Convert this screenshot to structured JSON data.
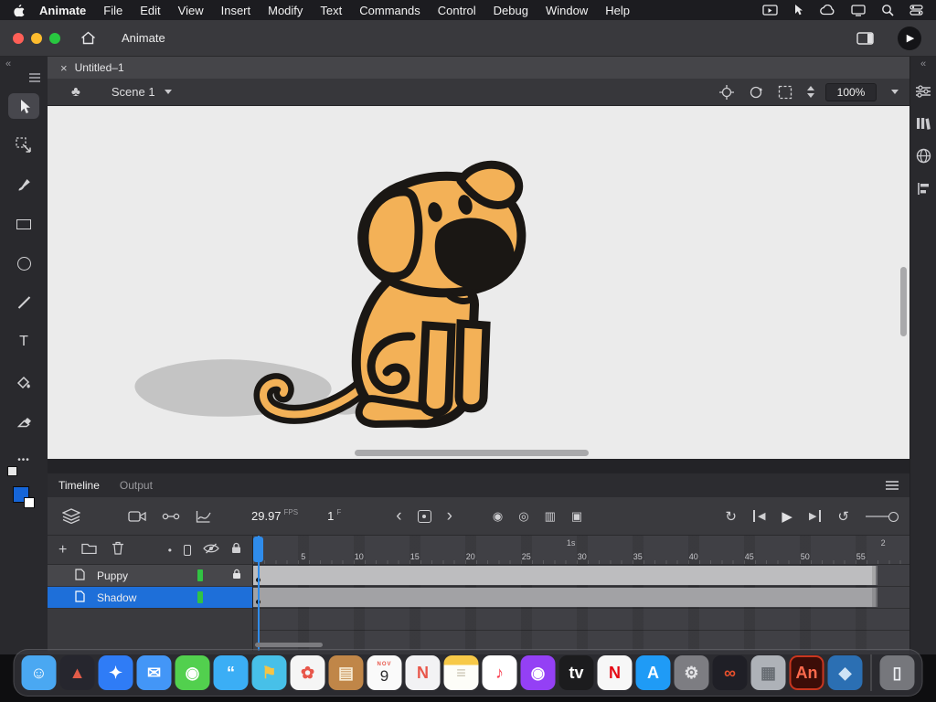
{
  "menu_bar": {
    "app_name": "Animate",
    "items": [
      "File",
      "Edit",
      "View",
      "Insert",
      "Modify",
      "Text",
      "Commands",
      "Control",
      "Debug",
      "Window",
      "Help"
    ]
  },
  "window": {
    "doc_tab": "Animate"
  },
  "document_tab": {
    "close": "×",
    "title": "Untitled–1"
  },
  "scene_bar": {
    "symbol_glyph": "♣",
    "scene_name": "Scene 1",
    "zoom_value": "100%"
  },
  "left_toolbar": {
    "text_tool_glyph": "T",
    "more_glyph": "•••"
  },
  "icons": {
    "collapse": "«",
    "prev": "‹",
    "next": "›",
    "play": "▶",
    "step_back": "◀",
    "step_fwd": "▶",
    "undo": "↺",
    "loop": "↻",
    "onion": [
      "◉",
      "◎",
      "▥",
      "▣"
    ],
    "dot": "•"
  },
  "timeline": {
    "tabs": {
      "timeline": "Timeline",
      "output": "Output"
    },
    "fps_value": "29.97",
    "fps_unit": "FPS",
    "frame_value": "1",
    "frame_unit": "F",
    "ruler_numbers": [
      5,
      10,
      15,
      20,
      25,
      30,
      35,
      40,
      45,
      50,
      55
    ],
    "seconds_marks": [
      {
        "label": "1s",
        "frame": 29
      },
      {
        "label": "2",
        "frame": 57
      }
    ],
    "frame_span_frames": 56,
    "layers": [
      {
        "name": "Puppy",
        "color": "#31c343",
        "locked": true,
        "selected": false
      },
      {
        "name": "Shadow",
        "color": "#31c343",
        "locked": false,
        "selected": true
      }
    ]
  },
  "stage": {
    "colors": {
      "background": "#ebebeb",
      "puppy": "#f3b157",
      "outline": "#1a1714",
      "shadow": "#c4c4c4"
    }
  },
  "ui_colors": {
    "selection_blue": "#1e6fd9",
    "playhead_blue": "#2f8ceb"
  },
  "dock": {
    "items": [
      {
        "name": "finder",
        "bg": "#4aa8f2",
        "glyph": "☺",
        "fg": "#ffffff"
      },
      {
        "name": "launchpad",
        "bg": "#26262e",
        "glyph": "▲",
        "fg": "#e25c49"
      },
      {
        "name": "safari",
        "bg": "#2f7cf6",
        "glyph": "✦",
        "fg": "#ffffff"
      },
      {
        "name": "mail",
        "bg": "#4396f7",
        "glyph": "✉",
        "fg": "#ffffff"
      },
      {
        "name": "facetime",
        "bg": "#52d04e",
        "glyph": "◉",
        "fg": "#ffffff"
      },
      {
        "name": "messages",
        "bg": "#3baef5",
        "glyph": "“",
        "fg": "#ffffff"
      },
      {
        "name": "maps",
        "bg": "#47c0e8",
        "glyph": "⚑",
        "fg": "#f6c445"
      },
      {
        "name": "photos",
        "bg": "#f5f5f5",
        "glyph": "✿",
        "fg": "#e8564a"
      },
      {
        "name": "books",
        "bg": "#c08648",
        "glyph": "▤",
        "fg": "#f6ead2"
      },
      {
        "name": "calendar",
        "bg": "#fafafa",
        "month": "NOV",
        "day": "9"
      },
      {
        "name": "news",
        "bg": "#f2f2f4",
        "glyph": "N",
        "fg": "#e8564a"
      },
      {
        "name": "notes",
        "bg": "linear-gradient(#f7c948 0 28%, #fdfdf8 28%)",
        "glyph": "≡",
        "fg": "#c9c4b2"
      },
      {
        "name": "music",
        "bg": "#ffffff",
        "glyph": "♪",
        "fg": "#fa3c4e"
      },
      {
        "name": "podcasts",
        "bg": "#9440f5",
        "glyph": "◉",
        "fg": "#ffffff"
      },
      {
        "name": "tv",
        "bg": "#1c1c1e",
        "glyph": "tv",
        "fg": "#ffffff"
      },
      {
        "name": "netflix",
        "bg": "#f7f7f7",
        "glyph": "N",
        "fg": "#e50914"
      },
      {
        "name": "app-store",
        "bg": "#1f9bf6",
        "glyph": "A",
        "fg": "#ffffff"
      },
      {
        "name": "system-preferences",
        "bg": "#7d7d82",
        "glyph": "⚙",
        "fg": "#e3e3e6"
      },
      {
        "name": "creative-cloud",
        "bg": "#1f1f26",
        "glyph": "∞",
        "fg": "#e9502c"
      },
      {
        "name": "stocks",
        "bg": "#aeb2b8",
        "glyph": "▦",
        "fg": "#686d73"
      },
      {
        "name": "adobe-animate",
        "bg": "#3c0d08",
        "glyph": "An",
        "fg": "#ff6a4d",
        "border": "#c9361f"
      },
      {
        "name": "parallels",
        "bg": "#2b6fb3",
        "glyph": "◆",
        "fg": "#cfe3f5"
      },
      {
        "divider": true
      },
      {
        "name": "trash",
        "bg": "rgba(210,212,218,0.45)",
        "glyph": "▯",
        "fg": "#eef0f4"
      }
    ]
  }
}
